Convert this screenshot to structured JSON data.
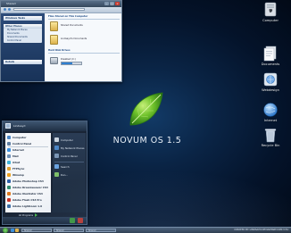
{
  "explorer": {
    "title": "Shared",
    "sidebar": {
      "tasks_header": "Windows Tasks",
      "other_places_header": "Other Places",
      "other_places": [
        "My Network Places",
        "Documents",
        "Shared Documents",
        "Control Panel"
      ],
      "details_header": "Details"
    },
    "content": {
      "files_header": "Files Stored on This Computer",
      "files": [
        "Shared Documents",
        "Lindsayd's Documents"
      ],
      "drives_header": "Hard Disk Drives",
      "drive": {
        "label": "Disabled (C:)",
        "fill_fraction": 0.55
      }
    }
  },
  "start_menu": {
    "user_name": "Lindsayd",
    "pinned": [
      "Computer",
      "Control Panel",
      "Internet",
      "Mail",
      "iChat",
      "FTPSync",
      "Winamp",
      "Adobe Photoshop CS3",
      "Adobe Dreamweaver CS3",
      "Adobe Illustrator CS3",
      "Adobe Flash CS3 Pro",
      "Adobe Lightroom 1.0"
    ],
    "all_programs": "All Programs",
    "right_items": [
      "Computer",
      "My Network Places",
      "Control Panel",
      "Search",
      "Run..."
    ]
  },
  "branding": {
    "os_name": "NOVUM OS 1.5"
  },
  "desktop_icons": [
    {
      "label": "Computer",
      "icon": "computer-icon",
      "color": "#d8dde4"
    },
    {
      "label": "Documents",
      "icon": "documents-icon",
      "color": "#f2f4f7"
    },
    {
      "label": "Webdesign",
      "icon": "webdesign-icon",
      "color": "#6fa8e6"
    },
    {
      "label": "Internet",
      "icon": "internet-icon",
      "color": "#2f86e0"
    },
    {
      "label": "Recycle Bin",
      "icon": "recycle-bin-icon",
      "color": "#c9d6e6"
    }
  ],
  "taskbar": {
    "tasks": [
      "Shared",
      "Shared",
      "Shared"
    ],
    "tray_text": "CREATED BY: LINDSAYD.DEVIANTART.COM    3:51"
  },
  "colors": {
    "accent_green": "#48b84b",
    "desktop_blue": "#0a2445",
    "close_red": "#c8392e"
  }
}
